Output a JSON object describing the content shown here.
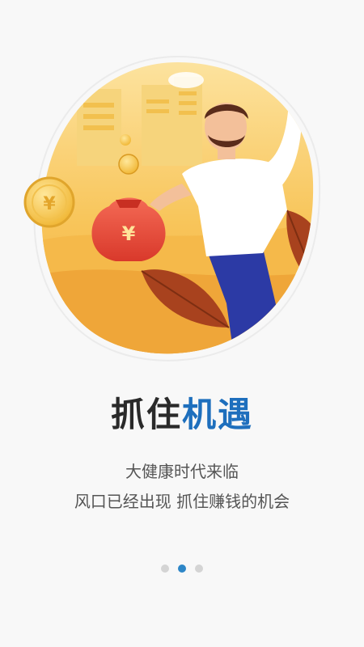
{
  "onboarding": {
    "title_dark": "抓住",
    "title_blue": "机遇",
    "subtitle_line1": "大健康时代来临",
    "subtitle_line2": "风口已经出现 抓住赚钱的机会",
    "coin_symbol": "¥"
  },
  "pager": {
    "page_count": 3,
    "active_index": 1
  },
  "colors": {
    "title_accent": "#1e6fbd",
    "indicator_active": "#2d86c7",
    "indicator_inactive": "#d4d4d4",
    "illustration_bg": "#f7c75a",
    "money_bag": "#e84b3c",
    "trousers": "#2c3aa5"
  }
}
